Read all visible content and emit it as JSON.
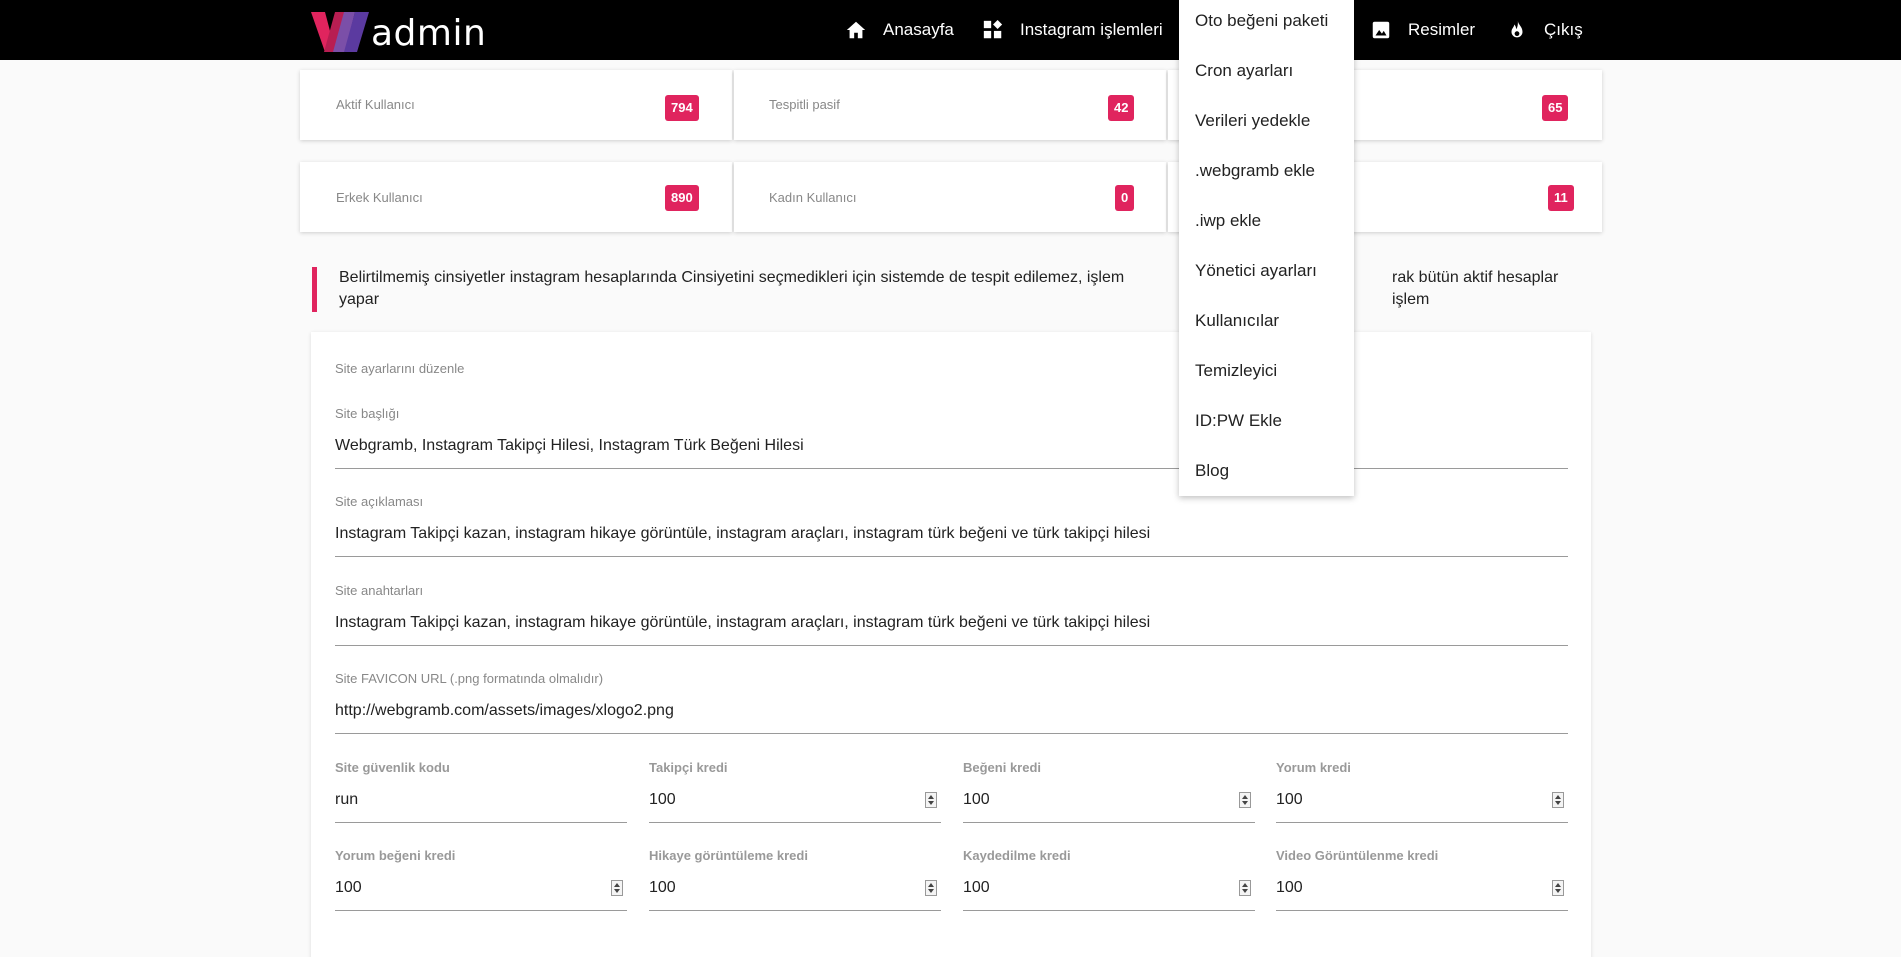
{
  "header": {
    "logo_text": "admin",
    "nav": {
      "home": "Anasayfa",
      "instagram": "Instagram işlemleri",
      "images": "Resimler",
      "logout": "Çıkış"
    }
  },
  "dropdown": {
    "items": [
      "Oto beğeni paketi",
      "Cron ayarları",
      "Verileri yedekle",
      ".webgramb ekle",
      ".iwp ekle",
      "Yönetici ayarları",
      "Kullanıcılar",
      "Temizleyici",
      "ID:PW Ekle",
      "Blog"
    ]
  },
  "stats": {
    "row1": [
      {
        "label": "Aktif Kullanıcı",
        "value": "794"
      },
      {
        "label": "Tespitli pasif",
        "value": "42"
      },
      {
        "label": "",
        "value": "65"
      }
    ],
    "row2": [
      {
        "label": "Erkek Kullanıcı",
        "value": "890"
      },
      {
        "label": "Kadın Kullanıcı",
        "value": "0"
      },
      {
        "label": "",
        "value": "11"
      }
    ]
  },
  "notice": {
    "text": "Belirtilmemiş cinsiyetler instagram hesaplarında Cinsiyetini seçmedikleri için sistemde de tespit edilemez, işlem",
    "text_right": "rak bütün aktif hesaplar işlem",
    "text_line2": "yapar"
  },
  "settings": {
    "title": "Site ayarlarını düzenle",
    "site_title": {
      "label": "Site başlığı",
      "value": "Webgramb, Instagram Takipçi Hilesi, Instagram Türk Beğeni Hilesi"
    },
    "site_description": {
      "label": "Site açıklaması",
      "value": "Instagram Takipçi kazan, instagram hikaye görüntüle,  instagram araçları, instagram türk beğeni ve türk takipçi hilesi"
    },
    "site_keywords": {
      "label": "Site anahtarları",
      "value": "Instagram Takipçi kazan, instagram hikaye görüntüle,  instagram araçları, instagram türk beğeni ve türk takipçi hilesi"
    },
    "site_favicon": {
      "label": "Site FAVICON URL (.png formatında olmalıdır)",
      "value": "http://webgramb.com/assets/images/xlogo2.png"
    },
    "security_code": {
      "label": "Site güvenlik kodu",
      "value": "run"
    },
    "follower_credit": {
      "label": "Takipçi kredi",
      "value": "100"
    },
    "like_credit": {
      "label": "Beğeni kredi",
      "value": "100"
    },
    "comment_credit": {
      "label": "Yorum kredi",
      "value": "100"
    },
    "comment_like_credit": {
      "label": "Yorum beğeni kredi",
      "value": "100"
    },
    "story_view_credit": {
      "label": "Hikaye görüntüleme kredi",
      "value": "100"
    },
    "save_credit": {
      "label": "Kaydedilme kredi",
      "value": "100"
    },
    "video_view_credit": {
      "label": "Video Görüntülenme kredi",
      "value": "100"
    }
  }
}
